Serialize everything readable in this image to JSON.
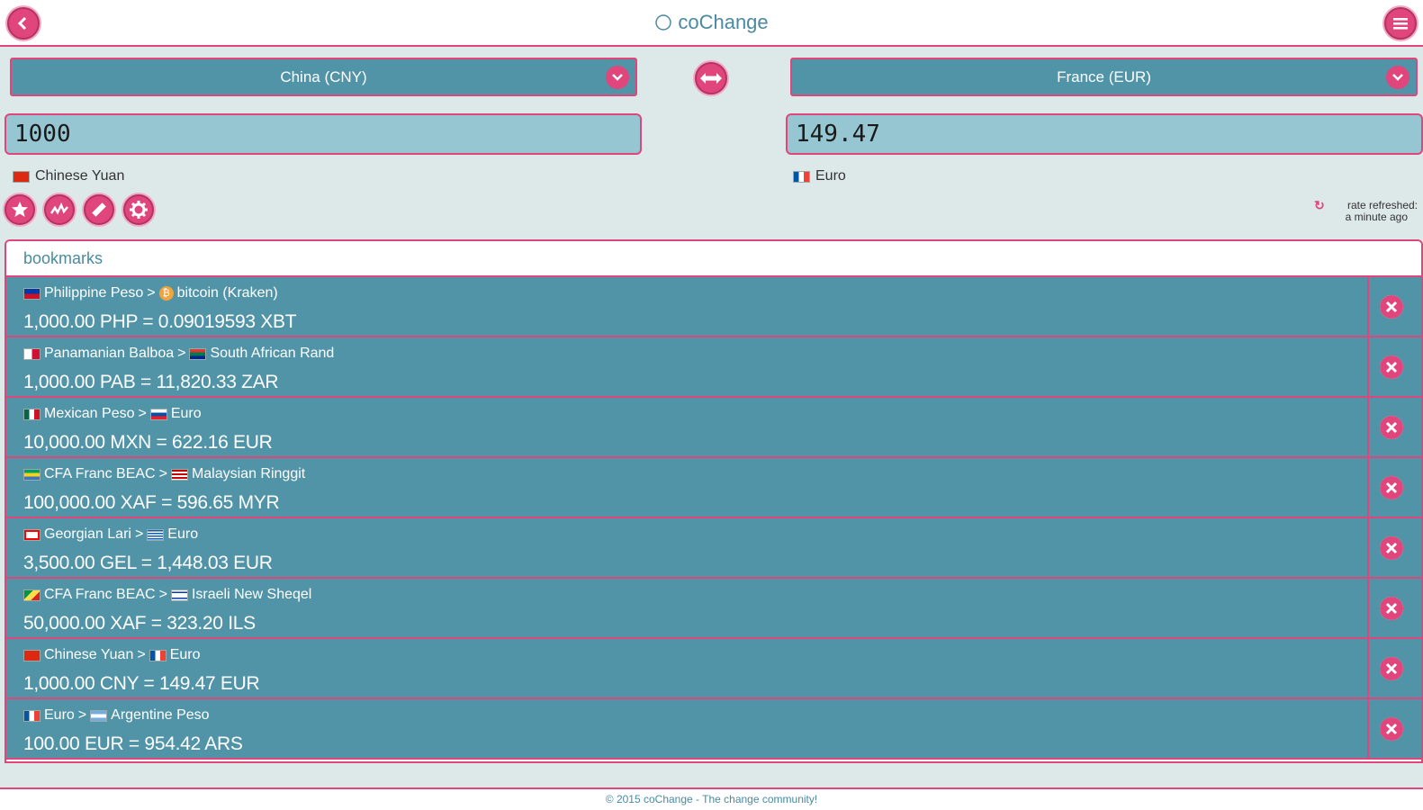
{
  "app": {
    "title": "coChange"
  },
  "converter": {
    "from_select": "China (CNY)",
    "to_select": "France (EUR)",
    "from_amount": "1000",
    "to_amount": "149.47",
    "from_currency_name": "Chinese Yuan",
    "to_currency_name": "Euro",
    "refresh_line1": "rate refreshed:",
    "refresh_line2": "a minute ago"
  },
  "bookmarks": {
    "title": "bookmarks",
    "items": [
      {
        "from": "Philippine Peso",
        "to": "bitcoin (Kraken)",
        "rate": "1,000.00 PHP = 0.09019593 XBT"
      },
      {
        "from": "Panamanian Balboa",
        "to": "South African Rand",
        "rate": "1,000.00 PAB = 11,820.33 ZAR"
      },
      {
        "from": "Mexican Peso",
        "to": "Euro",
        "rate": "10,000.00 MXN = 622.16 EUR"
      },
      {
        "from": "CFA Franc BEAC",
        "to": "Malaysian Ringgit",
        "rate": "100,000.00 XAF = 596.65 MYR"
      },
      {
        "from": "Georgian Lari",
        "to": "Euro",
        "rate": "3,500.00 GEL = 1,448.03 EUR"
      },
      {
        "from": "CFA Franc BEAC",
        "to": "Israeli New Sheqel",
        "rate": "50,000.00 XAF = 323.20 ILS"
      },
      {
        "from": "Chinese Yuan",
        "to": "Euro",
        "rate": "1,000.00 CNY = 149.47 EUR"
      },
      {
        "from": "Euro",
        "to": "Argentine Peso",
        "rate": "100.00 EUR = 954.42 ARS"
      }
    ],
    "separator": ">"
  },
  "footer": {
    "text": "© 2015 coChange - The change community!"
  },
  "colors": {
    "accent": "#e0457b",
    "panel": "#5194a8",
    "input": "#95c6d1",
    "background": "#dde9e8"
  }
}
